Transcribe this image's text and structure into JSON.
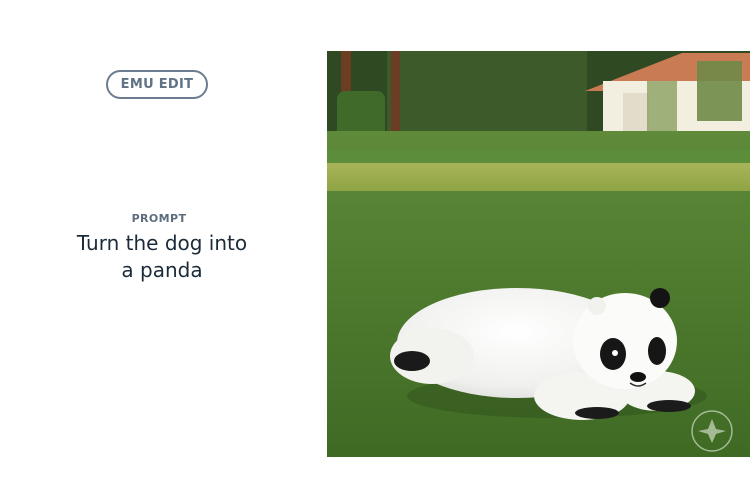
{
  "badge": {
    "label": "EMU EDIT"
  },
  "prompt": {
    "label": "PROMPT",
    "lines": [
      "Turn the dog into",
      "a panda"
    ]
  },
  "image": {
    "subject": "panda-lying-on-lawn"
  },
  "colors": {
    "badge_border": "#6b7d90",
    "label": "#5d6d7e",
    "text": "#1c2b39",
    "background": "#ffffff"
  }
}
